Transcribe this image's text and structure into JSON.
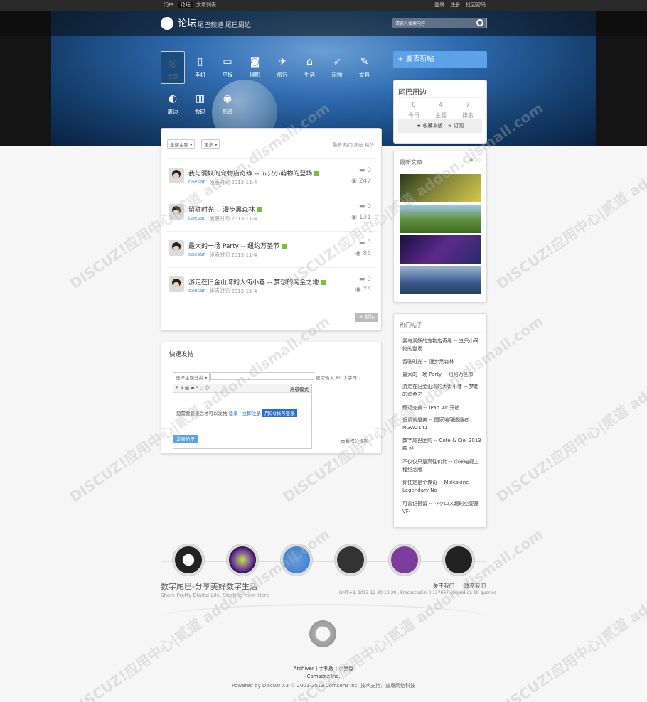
{
  "topbar": {
    "nav": [
      "门户",
      "论坛",
      "文章列表"
    ],
    "auth": [
      "登录",
      "注册",
      "找回密码"
    ]
  },
  "header": {
    "brand": "论坛",
    "links": [
      "尾巴频道",
      "尾巴周边"
    ],
    "search_placeholder": "请输入搜索内容"
  },
  "categories": [
    {
      "label": "全部",
      "icon": "all-icon",
      "glyph": "◎"
    },
    {
      "label": "手机",
      "icon": "phone-icon",
      "glyph": "▯"
    },
    {
      "label": "平板",
      "icon": "tablet-icon",
      "glyph": "▭"
    },
    {
      "label": "摄影",
      "icon": "camera-icon",
      "glyph": "◙"
    },
    {
      "label": "旅行",
      "icon": "plane-icon",
      "glyph": "✈"
    },
    {
      "label": "生活",
      "icon": "home-icon",
      "glyph": "⌂"
    },
    {
      "label": "玩物",
      "icon": "rocket-icon",
      "glyph": "➶"
    },
    {
      "label": "文具",
      "icon": "pen-icon",
      "glyph": "✎"
    },
    {
      "label": "周边",
      "icon": "mouse-icon",
      "glyph": "◐"
    },
    {
      "label": "数码",
      "icon": "ipod-icon",
      "glyph": "▥"
    },
    {
      "label": "影音",
      "icon": "speaker-icon",
      "glyph": "◉"
    }
  ],
  "new_post_label": "+ 发表新帖",
  "forum_box": {
    "title": "尾巴周边",
    "stats": [
      {
        "value": "0",
        "label": "今日"
      },
      {
        "value": "4",
        "label": "主题"
      },
      {
        "value": "7",
        "label": "排名"
      }
    ],
    "fav_label": "收藏本版",
    "rss_label": "订阅"
  },
  "thread_list": {
    "filters": [
      "全部主题",
      "更多"
    ],
    "sorts": "最新 热门 热帖 精华",
    "threads": [
      {
        "title": "我与洞妖的宠物店奇缘 -- 五只小萌物的登场",
        "author": "caesar",
        "meta": "发表时间 2013-11-4",
        "replies": "0",
        "views": "247"
      },
      {
        "title": "留驻时光 -- 漫步黑森林",
        "author": "caesar",
        "meta": "发表时间 2013-11-4",
        "replies": "0",
        "views": "131"
      },
      {
        "title": "最大的一场 Party -- 纽约万圣节",
        "author": "caesar",
        "meta": "发表时间 2013-11-4",
        "replies": "0",
        "views": "86"
      },
      {
        "title": "游走在旧金山湾的大街小巷 -- 梦想的淘金之地",
        "author": "caesar",
        "meta": "发表时间 2013-11-4",
        "replies": "0",
        "views": "76"
      }
    ],
    "new_button": "+ 新帖"
  },
  "quick_post": {
    "title": "快速发帖",
    "select": "选择主题分类",
    "char_hint": "还可输入 80 个字符",
    "advanced": "高级模式",
    "login_hint": "您需要登录后才可以发帖",
    "login": "登录",
    "register": "立即注册",
    "qq_login": "用QQ帐号登录",
    "submit": "发表帖子",
    "rules": "本版积分规则"
  },
  "latest": {
    "title": "最新文章"
  },
  "hot": {
    "title": "热门帖子",
    "items": [
      "我与洞妖的宠物店奇缘 -- 五只小萌物的登场",
      "留驻时光 -- 漫步黑森林",
      "最大的一场 Party -- 纽约万圣节",
      "游走在旧金山湾的大街小巷 -- 梦想的淘金之",
      "臻近完美 -- iPad Air 开箱",
      "低调就是美 -- 国家地理透通者 NGW2141",
      "数字尾巴团购 -- Cote & Ciel 2013款 经",
      "不仅仅只是高性价比 -- 小米电视工程纪念版",
      "你住定是个传奇 -- Moleskine Legendary No",
      "可曾记得留 -- マクロス超时空要塞VF-"
    ]
  },
  "footer": {
    "slogan": "数字尾巴-分享美好数字生活",
    "sub": "Share Pretty Digital Life, Starting from Here",
    "links": [
      "关于我们",
      "联系我们"
    ],
    "gmt": "GMT+8, 2013-12-30 10:20 , Processed in 0.137667 second(s), 19 queries .",
    "bottom_links": [
      "Archiver",
      "手机版",
      "小黑屋"
    ],
    "company": "Comsenz Inc.",
    "powered": "Powered by Discuz! X3 © 2001-2013 Comsenz Inc. 技术支持：迪恩网络科技"
  },
  "watermark": "DISCUZ!应用中心|贰道 addon.dismall.com",
  "colors": {
    "accent": "#5da1e8",
    "link": "#4a90d9",
    "topbar": "#2a2a2a"
  }
}
